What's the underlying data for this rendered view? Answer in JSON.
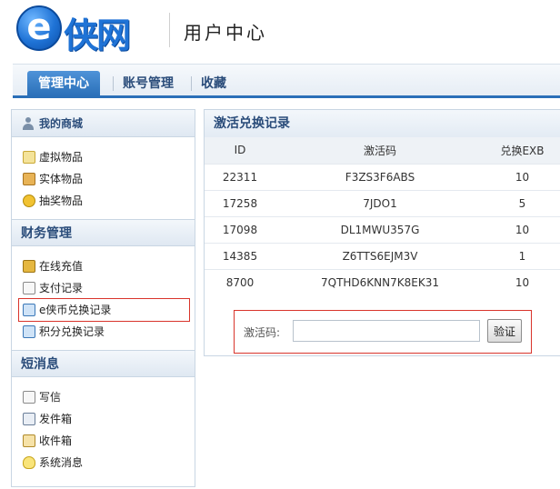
{
  "header": {
    "logo_letter": "e",
    "logo_text": "侠网",
    "title": "用户中心"
  },
  "nav": {
    "tabs": [
      {
        "label": "管理中心",
        "active": true
      },
      {
        "label": "账号管理",
        "active": false
      },
      {
        "label": "收藏",
        "active": false
      }
    ]
  },
  "sidebar": {
    "sections": [
      {
        "title": "我的商城",
        "items": [
          {
            "label": "虚拟物品",
            "icon": "note-icon"
          },
          {
            "label": "实体物品",
            "icon": "box-icon"
          },
          {
            "label": "抽奖物品",
            "icon": "coin-icon"
          }
        ]
      },
      {
        "title": "财务管理",
        "items": [
          {
            "label": "在线充值",
            "icon": "coin-stack-icon"
          },
          {
            "label": "支付记录",
            "icon": "document-icon"
          },
          {
            "label": "e侠币兑换记录",
            "icon": "mail-icon",
            "highlighted": true
          },
          {
            "label": "积分兑换记录",
            "icon": "mail-icon"
          }
        ]
      },
      {
        "title": "短消息",
        "items": [
          {
            "label": "写信",
            "icon": "write-icon"
          },
          {
            "label": "发件箱",
            "icon": "outbox-icon"
          },
          {
            "label": "收件箱",
            "icon": "inbox-icon"
          },
          {
            "label": "系统消息",
            "icon": "bulb-icon"
          }
        ]
      }
    ]
  },
  "main": {
    "title": "激活兑换记录",
    "table": {
      "headers": [
        "ID",
        "激活码",
        "兑换EXB"
      ],
      "rows": [
        [
          "22311",
          "F3ZS3F6ABS",
          "10"
        ],
        [
          "17258",
          "7JDO1",
          "5"
        ],
        [
          "17098",
          "DL1MWU357G",
          "10"
        ],
        [
          "14385",
          "Z6TTS6EJM3V",
          "1"
        ],
        [
          "8700",
          "7QTHD6KNN7K8EK31",
          "10"
        ]
      ]
    },
    "verify": {
      "label": "激活码:",
      "value": "",
      "button": "验证"
    }
  },
  "colors": {
    "accent": "#2a6fb8",
    "highlight_border": "#d9342b",
    "heading_text": "#2a4c7a"
  }
}
